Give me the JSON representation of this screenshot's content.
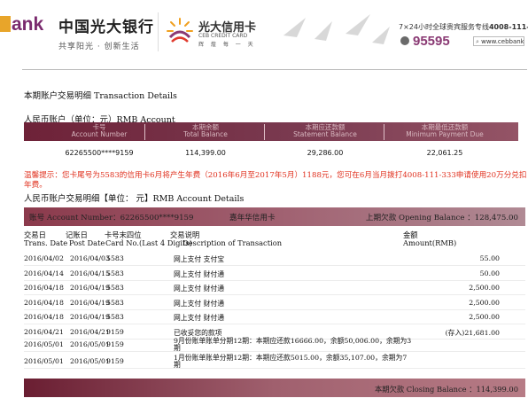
{
  "header": {
    "logo_bank": "ank",
    "logo_cn": "中国光大银行",
    "slogan": "共享阳光 · 创新生活",
    "card_cn": "光大信用卡",
    "card_en": "CEB CREDIT CARD",
    "card_sub": "辉 煌 每 一 天",
    "hotline_label": "7×24小时全球贵宾服务专线",
    "hotline_number": "4008-111-333",
    "phone": "95595",
    "site": "www.cebbank.com",
    "site_icon": "search-icon"
  },
  "statement": {
    "title": "本期账户交易明细 Transaction Details",
    "rmb_title": "人民币账户（单位：元）RMB Account",
    "headers": [
      "卡号\nAccount Number",
      "本期余额\nTotal Balance",
      "本期应还款额\nStatement Balance",
      "本期最低还款额\nMinimum Payment Due"
    ],
    "values": [
      "62265500****9159",
      "114,399.00",
      "29,286.00",
      "22,061.25"
    ],
    "notice": "温馨提示：您卡尾号为5583的信用卡6月将产生年费（2016年6月至2017年5月）1188元，您可在6月当月拨打4008-111-333申请使用20万分兑扣年费。",
    "detail_title": "人民币账户交易明细【单位： 元】RMB Account Details"
  },
  "detail_bar": {
    "account_label": "账号 Account Number：62265500****9159",
    "card_name": "嘉年华信用卡",
    "opening": "上期欠款 Opening Balance ：128,475.00"
  },
  "columns": {
    "trans_date": "交易日",
    "trans_date_en": "Trans. Date",
    "post_date": "记账日",
    "post_date_en": "Post Date",
    "card_no": "卡号末四位",
    "card_no_en": "Card No.(Last 4 Digits)",
    "desc": "交易说明",
    "desc_en": "Description of Transaction",
    "amount": "金额",
    "amount_en": "Amount(RMB)"
  },
  "transactions": [
    {
      "date": "2016/04/02",
      "post": "2016/04/03",
      "card": "5583",
      "desc": "网上支付 支付宝",
      "amount": "55.00"
    },
    {
      "date": "2016/04/14",
      "post": "2016/04/15",
      "card": "5583",
      "desc": "网上支付 财付通",
      "amount": "50.00"
    },
    {
      "date": "2016/04/18",
      "post": "2016/04/19",
      "card": "5583",
      "desc": "网上支付 财付通",
      "amount": "2,500.00"
    },
    {
      "date": "2016/04/18",
      "post": "2016/04/19",
      "card": "5583",
      "desc": "网上支付 财付通",
      "amount": "2,500.00"
    },
    {
      "date": "2016/04/18",
      "post": "2016/04/19",
      "card": "5583",
      "desc": "网上支付 财付通",
      "amount": "2,500.00"
    },
    {
      "date": "2016/04/21",
      "post": "2016/04/21",
      "card": "9159",
      "desc": "已收妥您的款项",
      "amount": "(存入)21,681.00"
    },
    {
      "date": "2016/05/01",
      "post": "2016/05/01",
      "card": "9159",
      "desc": "9月份账单账单分期12期：本期应还款16666.00，余额50,006.00，余期为3期",
      "amount": ""
    },
    {
      "date": "2016/05/01",
      "post": "2016/05/01",
      "card": "9159",
      "desc": "1月份账单账单分期12期：本期应还款5015.00，余额35,107.00，余期为7期",
      "amount": ""
    }
  ],
  "closing": "本期欠款 Closing Balance ：114,399.00"
}
